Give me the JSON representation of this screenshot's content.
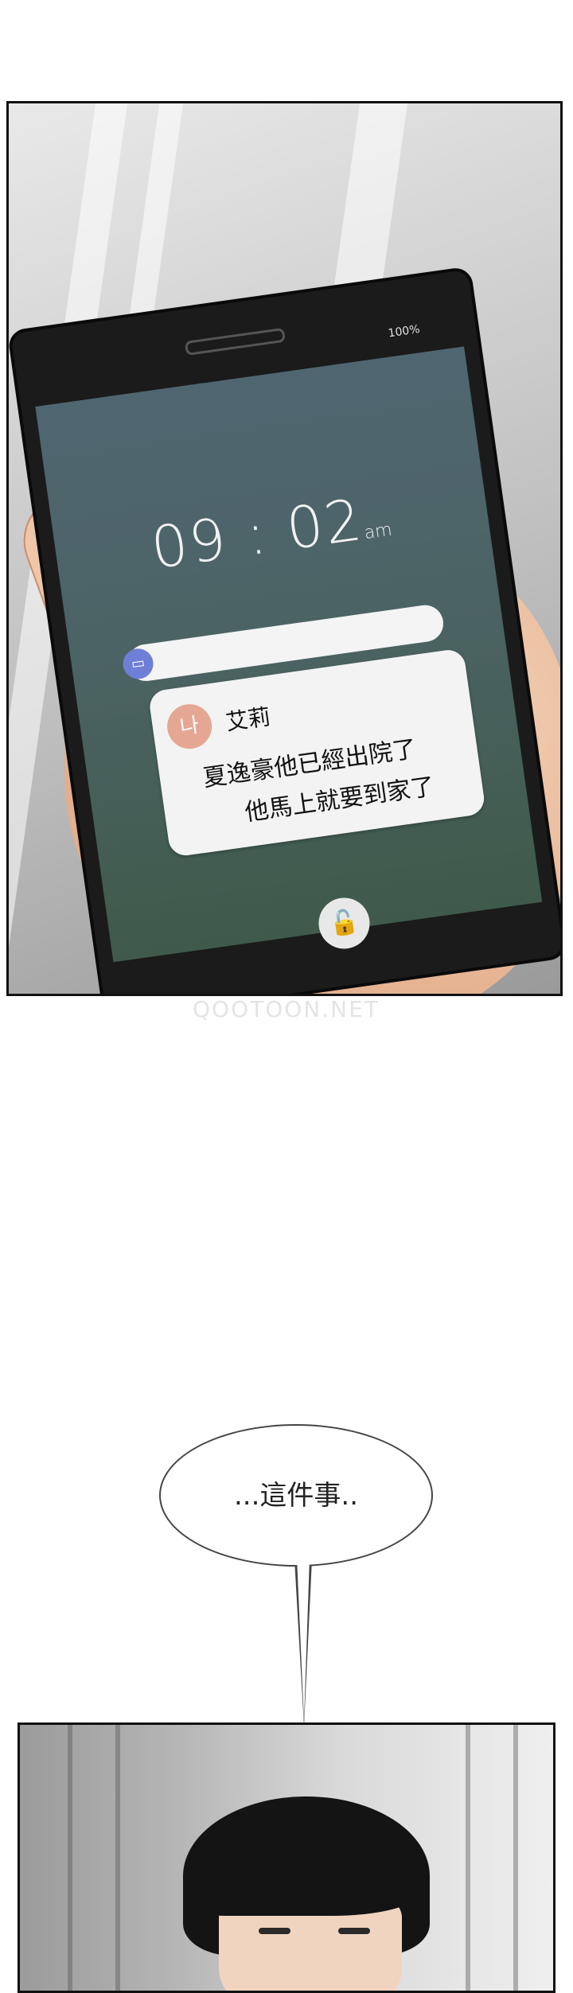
{
  "phone": {
    "battery": "100%",
    "signal": "●●●●● ",
    "time": "09 : 02",
    "ampm": "am",
    "app_icon": "chat-icon",
    "notification": {
      "avatar_text": "나",
      "sender": "艾莉",
      "line1": "夏逸豪他已經出院了",
      "line2": "他馬上就要到家了"
    },
    "unlock_icon": "unlock-icon"
  },
  "watermark": "QOOTOON.NET",
  "bubble": {
    "text": "...這件事.."
  }
}
